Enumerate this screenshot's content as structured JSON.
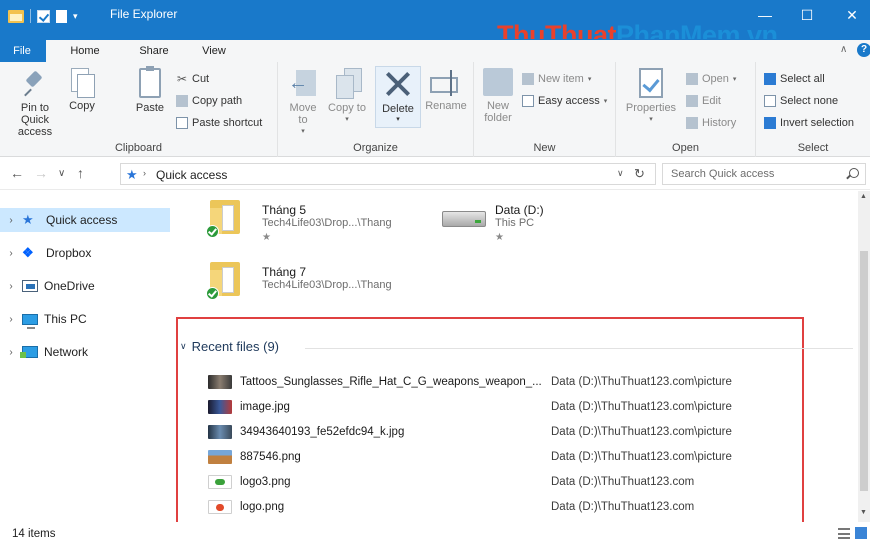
{
  "window": {
    "title": "File Explorer",
    "watermark_part1": "ThuThuat",
    "watermark_part2": "PhanMem.vn",
    "minimize_symbol": "—",
    "maximize_symbol": "☐",
    "close_symbol": "✕",
    "qat_dropdown_symbol": "▾"
  },
  "tabs": {
    "file": "File",
    "home": "Home",
    "share": "Share",
    "view": "View",
    "collapse_symbol": "∧",
    "help_symbol": "?"
  },
  "ribbon": {
    "clipboard": {
      "label": "Clipboard",
      "pin_to_quick_access": "Pin to Quick access",
      "copy": "Copy",
      "paste": "Paste",
      "cut": "Cut",
      "copy_path": "Copy path",
      "paste_shortcut": "Paste shortcut"
    },
    "organize": {
      "label": "Organize",
      "move_to": "Move to",
      "copy_to": "Copy to",
      "delete": "Delete",
      "rename": "Rename"
    },
    "new": {
      "label": "New",
      "new_folder": "New folder",
      "new_item": "New item",
      "easy_access": "Easy access"
    },
    "open": {
      "label": "Open",
      "properties": "Properties",
      "open": "Open",
      "edit": "Edit",
      "history": "History"
    },
    "select": {
      "label": "Select",
      "select_all": "Select all",
      "select_none": "Select none",
      "invert_selection": "Invert selection"
    }
  },
  "address": {
    "back_symbol": "←",
    "forward_symbol": "→",
    "recent_symbol": "∨",
    "up_symbol": "↑",
    "path": "Quick access",
    "separator": "›",
    "dropdown_symbol": "∨",
    "refresh_symbol": "↻",
    "search_placeholder": "Search Quick access"
  },
  "nav": {
    "items": [
      {
        "label": "Quick access",
        "icon": "quick-access-star-icon",
        "selected": true
      },
      {
        "label": "Dropbox",
        "icon": "dropbox-icon"
      },
      {
        "label": "OneDrive",
        "icon": "onedrive-icon"
      },
      {
        "label": "This PC",
        "icon": "this-pc-icon"
      },
      {
        "label": "Network",
        "icon": "network-icon"
      }
    ],
    "expand_symbol": "›"
  },
  "pinned": [
    {
      "name": "Tháng 5",
      "path": "Tech4Life03\\Drop...\\Thang",
      "type": "folder",
      "pin": "★"
    },
    {
      "name": "Data (D:)",
      "path": "This PC",
      "type": "drive",
      "pin": "★"
    },
    {
      "name": "Tháng 7",
      "path": "Tech4Life03\\Drop...\\Thang",
      "type": "folder"
    }
  ],
  "recent": {
    "header": "Recent files (9)",
    "collapse_symbol": "∨",
    "files": [
      {
        "name": "Tattoos_Sunglasses_Rifle_Hat_C_G_weapons_weapon_...",
        "location": "Data (D:)\\ThuThuat123.com\\picture"
      },
      {
        "name": "image.jpg",
        "location": "Data (D:)\\ThuThuat123.com\\picture"
      },
      {
        "name": "34943640193_fe52efdc94_k.jpg",
        "location": "Data (D:)\\ThuThuat123.com\\picture"
      },
      {
        "name": "887546.png",
        "location": "Data (D:)\\ThuThuat123.com\\picture"
      },
      {
        "name": "logo3.png",
        "location": "Data (D:)\\ThuThuat123.com"
      },
      {
        "name": "logo.png",
        "location": "Data (D:)\\ThuThuat123.com"
      }
    ]
  },
  "status": {
    "items_count": "14 items"
  },
  "colors": {
    "accent": "#1979ca",
    "selection": "#cce8ff",
    "highlight_box": "#e04040"
  }
}
